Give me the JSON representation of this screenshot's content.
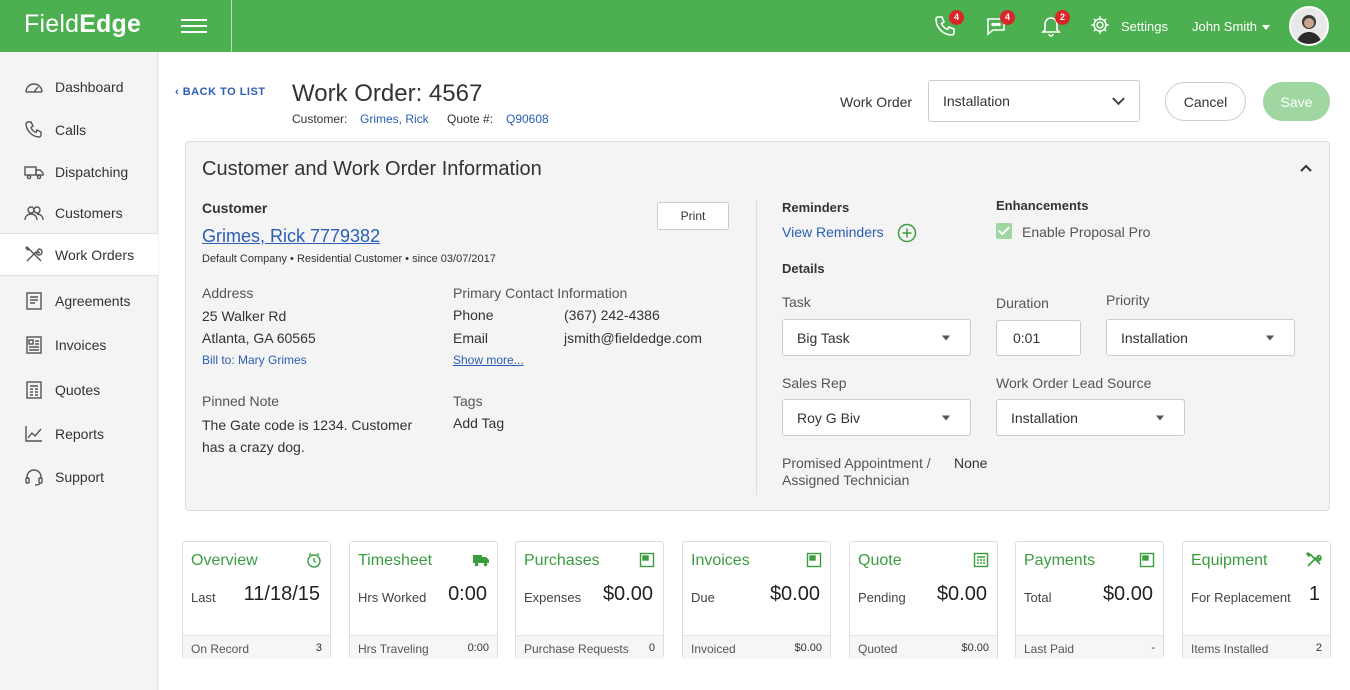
{
  "app": {
    "logo_light": "Field",
    "logo_bold": "Edge"
  },
  "topbar": {
    "calls_badge": "4",
    "messages_badge": "4",
    "notifications_badge": "2",
    "settings_label": "Settings",
    "user_name": "John Smith"
  },
  "sidebar": {
    "items": [
      {
        "label": "Dashboard",
        "icon": "dashboard-icon"
      },
      {
        "label": "Calls",
        "icon": "phone-icon"
      },
      {
        "label": "Dispatching",
        "icon": "truck-icon"
      },
      {
        "label": "Customers",
        "icon": "customers-icon"
      },
      {
        "label": "Work Orders",
        "icon": "tools-icon"
      },
      {
        "label": "Agreements",
        "icon": "agreement-icon"
      },
      {
        "label": "Invoices",
        "icon": "invoice-icon"
      },
      {
        "label": "Quotes",
        "icon": "quote-icon"
      },
      {
        "label": "Reports",
        "icon": "chart-icon"
      },
      {
        "label": "Support",
        "icon": "headset-icon"
      }
    ],
    "active": "Work Orders"
  },
  "header": {
    "back_label": "BACK TO LIST",
    "title": "Work Order: 4567",
    "customer_label": "Customer:",
    "customer_value": "Grimes, Rick",
    "quote_label": "Quote #:",
    "quote_value": "Q90608",
    "type_label": "Work Order",
    "type_value": "Installation",
    "cancel_label": "Cancel",
    "save_label": "Save"
  },
  "panel": {
    "title": "Customer and Work Order Information",
    "customer_heading": "Customer",
    "customer_name": "Grimes, Rick 7779382",
    "customer_meta": "Default Company • Residential Customer • since 03/07/2017",
    "print_label": "Print",
    "address_label": "Address",
    "address_line1": "25 Walker Rd",
    "address_line2": "Atlanta,  GA 60565",
    "bill_to": "Bill to: Mary Grimes",
    "contact_label": "Primary Contact Information",
    "phone_label": "Phone",
    "phone_value": "(367) 242-4386",
    "email_label": "Email",
    "email_value": "jsmith@fieldedge.com",
    "show_more": "Show more...",
    "pinned_label": "Pinned Note",
    "pinned_line1": "The Gate code is 1234. Customer",
    "pinned_line2": "has a crazy dog.",
    "tags_label": "Tags",
    "add_tag": "Add Tag",
    "reminders_label": "Reminders",
    "view_reminders": "View Reminders",
    "enhancements_label": "Enhancements",
    "enable_proposal": "Enable Proposal Pro",
    "details_label": "Details",
    "task_label": "Task",
    "task_value": "Big Task",
    "duration_label": "Duration",
    "duration_value": "0:01",
    "priority_label": "Priority",
    "priority_value": "Installation",
    "sales_rep_label": "Sales Rep",
    "sales_rep_value": "Roy G Biv",
    "lead_source_label": "Work Order Lead Source",
    "lead_source_value": "Installation",
    "promised_line1": "Promised Appointment /",
    "promised_line2": "Assigned Technician",
    "promised_value": "None"
  },
  "cards": [
    {
      "title": "Overview",
      "icon": "clock-icon",
      "label": "Last",
      "value": "11/18/15",
      "foot_label": "On Record",
      "foot_value": "3"
    },
    {
      "title": "Timesheet",
      "icon": "truck-icon",
      "label": "Hrs Worked",
      "value": "0:00",
      "foot_label": "Hrs Traveling",
      "foot_value": "0:00"
    },
    {
      "title": "Purchases",
      "icon": "document-icon",
      "label": "Expenses",
      "value": "$0.00",
      "foot_label": "Purchase Requests",
      "foot_value": "0"
    },
    {
      "title": "Invoices",
      "icon": "document-icon",
      "label": "Due",
      "value": "$0.00",
      "foot_label": "Invoiced",
      "foot_value": "$0.00"
    },
    {
      "title": "Quote",
      "icon": "calculator-icon",
      "label": "Pending",
      "value": "$0.00",
      "foot_label": "Quoted",
      "foot_value": "$0.00"
    },
    {
      "title": "Payments",
      "icon": "document-icon",
      "label": "Total",
      "value": "$0.00",
      "foot_label": "Last Paid",
      "foot_value": "-"
    },
    {
      "title": "Equipment",
      "icon": "tools-icon",
      "label": "For Replacement",
      "value": "1",
      "foot_label": "Items Installed",
      "foot_value": "2"
    }
  ],
  "colors": {
    "brand": "#4caf50",
    "link": "#2a5eb5",
    "badge": "#d9262b"
  }
}
